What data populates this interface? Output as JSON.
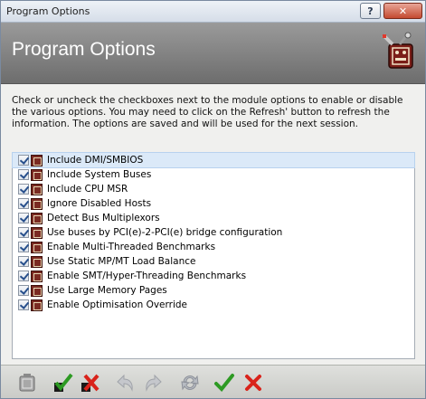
{
  "window": {
    "title": "Program Options",
    "help_label": "?",
    "close_label": "✕"
  },
  "header": {
    "title": "Program Options"
  },
  "description": "Check or uncheck the checkboxes next to the module options to enable or disable the various options. You may need to click on the Refresh' button to refresh the information. The options are saved and will be used for the next session.",
  "options": [
    {
      "label": "Include DMI/SMBIOS",
      "checked": true
    },
    {
      "label": "Include System Buses",
      "checked": true
    },
    {
      "label": "Include CPU MSR",
      "checked": true
    },
    {
      "label": "Ignore Disabled Hosts",
      "checked": true
    },
    {
      "label": "Detect Bus Multiplexors",
      "checked": true
    },
    {
      "label": "Use buses by PCI(e)-2-PCI(e) bridge configuration",
      "checked": true
    },
    {
      "label": "Enable Multi-Threaded Benchmarks",
      "checked": true
    },
    {
      "label": "Use Static MP/MT Load Balance",
      "checked": true
    },
    {
      "label": "Enable SMT/Hyper-Threading Benchmarks",
      "checked": true
    },
    {
      "label": "Use Large Memory Pages",
      "checked": true
    },
    {
      "label": "Enable Optimisation Override",
      "checked": true
    }
  ],
  "selected_index": 0,
  "toolbar": {
    "icons": [
      "module-icon",
      "check-all-icon",
      "uncheck-all-icon",
      "undo-icon",
      "redo-icon",
      "refresh-icon",
      "ok-icon",
      "cancel-icon"
    ]
  },
  "colors": {
    "header_bg": "#7d7d7d",
    "selection": "#dbe9f8",
    "ok_green": "#2d9a23",
    "cancel_red": "#d9231b"
  }
}
